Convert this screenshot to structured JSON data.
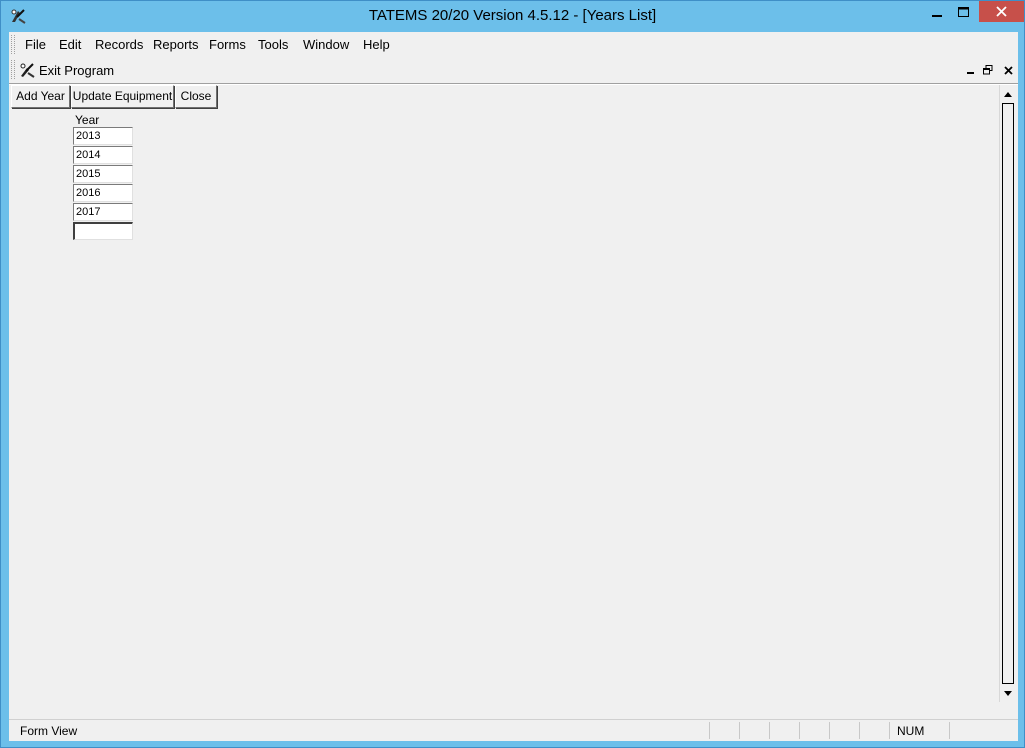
{
  "window": {
    "title": "TATEMS 20/20 Version 4.5.12 - [Years List]",
    "accent": "#6cbfea",
    "close_color": "#c7504a"
  },
  "menu": {
    "items": [
      {
        "label": "File",
        "icon": "file-menu"
      },
      {
        "label": "Edit",
        "icon": "edit-menu"
      },
      {
        "label": "Records",
        "icon": "records-menu"
      },
      {
        "label": "Reports",
        "icon": "reports-menu"
      },
      {
        "label": "Forms",
        "icon": "forms-menu"
      },
      {
        "label": "Tools",
        "icon": "tools-menu"
      },
      {
        "label": "Window",
        "icon": "window-menu"
      },
      {
        "label": "Help",
        "icon": "help-menu"
      }
    ]
  },
  "toolbar": {
    "exit_label": "Exit Program",
    "exit_icon": "exit-program-icon"
  },
  "form": {
    "buttons": {
      "add_year": "Add Year",
      "update_equipment": "Update Equipment",
      "close": "Close"
    },
    "column_header": "Year",
    "years": [
      "2013",
      "2014",
      "2015",
      "2016",
      "2017",
      ""
    ]
  },
  "status": {
    "view": "Form View",
    "num": "NUM"
  }
}
